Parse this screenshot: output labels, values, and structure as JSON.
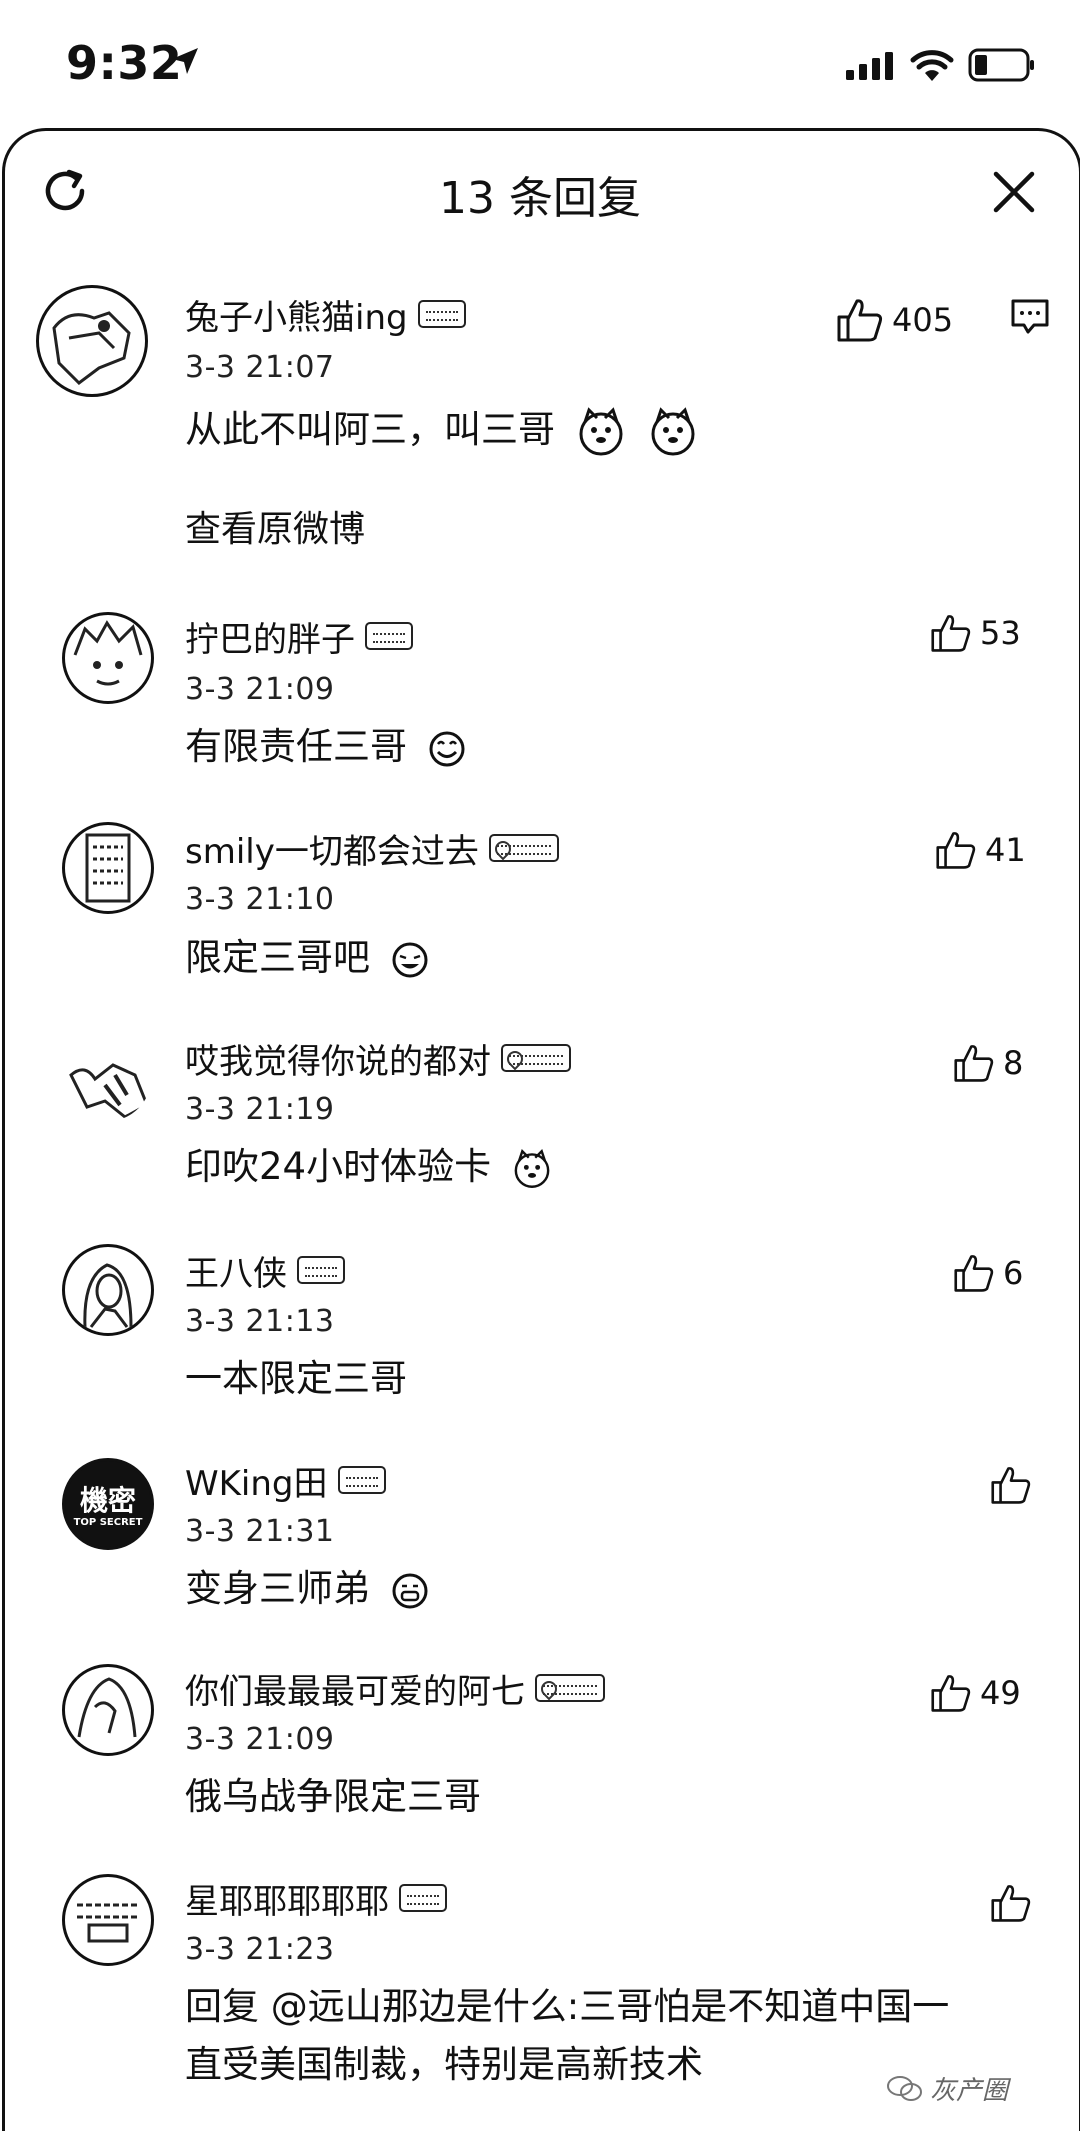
{
  "status_bar": {
    "time": "9:32"
  },
  "header": {
    "title": "13 条回复"
  },
  "main_comment": {
    "author": "兔子小熊猫ing",
    "time": "3-3 21:07",
    "text": "从此不叫阿三，叫三哥",
    "likes": "405",
    "view_original": "查看原微博"
  },
  "replies": [
    {
      "author": "拧巴的胖子",
      "time": "3-3 21:09",
      "text": "有限责任三哥",
      "likes": "53"
    },
    {
      "author": "smily一切都会过去",
      "time": "3-3 21:10",
      "text": "限定三哥吧",
      "likes": "41"
    },
    {
      "author": "哎我觉得你说的都对",
      "time": "3-3 21:19",
      "text": "印吹24小时体验卡",
      "likes": "8"
    },
    {
      "author": "王八侠",
      "time": "3-3 21:13",
      "text": "一本限定三哥",
      "likes": "6"
    },
    {
      "author": "WKing田",
      "time": "3-3 21:31",
      "text": "变身三师弟",
      "likes": ""
    },
    {
      "author": "你们最最最可爱的阿七",
      "time": "3-3 21:09",
      "text": "俄乌战争限定三哥",
      "likes": "49"
    },
    {
      "author": "星耶耶耶耶耶",
      "time": "3-3 21:23",
      "text_line1": "回复 @远山那边是什么:三哥怕是不知道中国一",
      "text_line2": "直受美国制裁，特别是高新技术",
      "likes": ""
    }
  ],
  "avatar_texts": {
    "wking_top": "機密",
    "wking_bottom": "TOP SECRET"
  },
  "watermark": {
    "text": "灰产圈"
  }
}
